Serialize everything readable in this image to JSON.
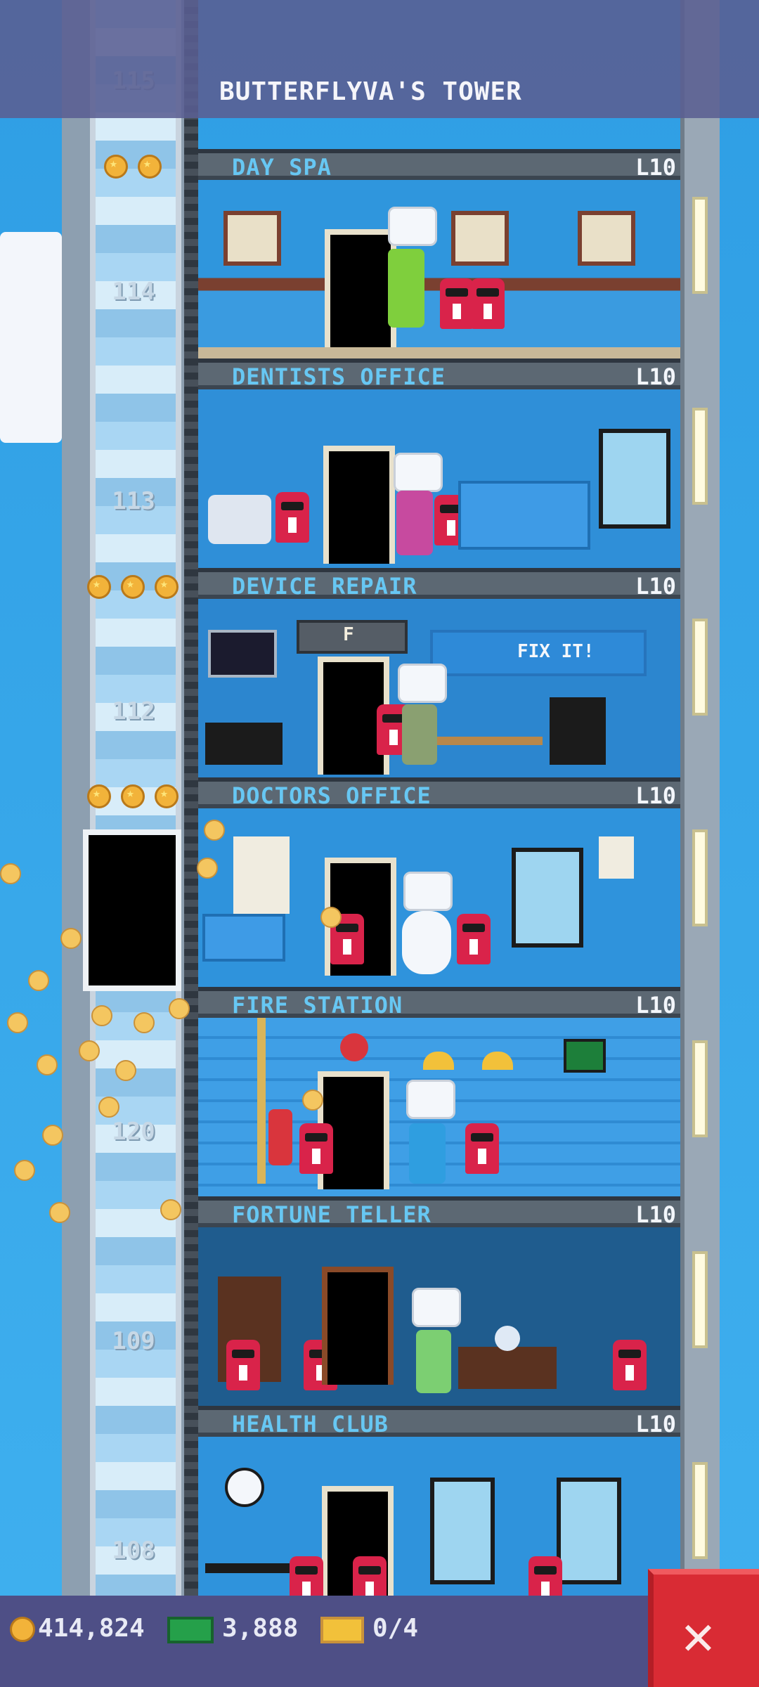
{
  "tower": {
    "title": "BUTTERFLYVA'S TOWER"
  },
  "floor_numbers": [
    "115",
    "114",
    "113",
    "112",
    "120",
    "109",
    "108"
  ],
  "floors": [
    {
      "name": "DAY SPA",
      "level": "L10"
    },
    {
      "name": "DENTISTS OFFICE",
      "level": "L10"
    },
    {
      "name": "DEVICE REPAIR",
      "level": "L10",
      "sign": "FIX IT!",
      "letter": "F"
    },
    {
      "name": "DOCTORS OFFICE",
      "level": "L10"
    },
    {
      "name": "FIRE STATION",
      "level": "L10"
    },
    {
      "name": "FORTUNE TELLER",
      "level": "L10"
    },
    {
      "name": "HEALTH CLUB",
      "level": "L10"
    }
  ],
  "status": {
    "coins": "414,824",
    "bux": "3,888",
    "tickets": "0/4"
  },
  "icons": {
    "coin": "coin-icon",
    "bux": "bux-icon",
    "ticket": "golden-ticket-icon",
    "close": "close-icon"
  },
  "colors": {
    "accent_label": "#67c7f3",
    "close_button": "#d92b34",
    "bottom_bar": "#4e4f86"
  }
}
